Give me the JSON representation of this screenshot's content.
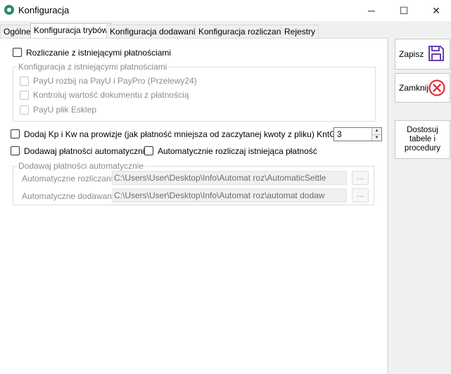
{
  "window": {
    "title": "Konfiguracja",
    "minimize": "─",
    "maximize": "☐",
    "close": "✕"
  },
  "tabs": [
    "Ogólne",
    "Konfiguracja trybów",
    "Konfiguracja dodawania",
    "Konfiguracja rozliczania",
    "Rejestry"
  ],
  "active_tab": 1,
  "settlement": {
    "checkbox_label": "Rozliczanie z istniejącymi płatnościami",
    "group_title": "Konfiguracja z istniejącymi płatnościami",
    "options": [
      "PayU rozbij na PayU i PayPro (Przelewy24)",
      "Kontroluj wartość dokumentu z płatnością",
      "PayU plik Esklep"
    ]
  },
  "commission": {
    "checkbox_label": "Dodaj Kp i Kw na prowizje (jak płatność mniejsza od zaczytanej kwoty z pliku) KntGidNumer:",
    "kntgid_value": "3"
  },
  "auto_add": {
    "checkbox_label": "Dodawaj płatności automatycznie"
  },
  "auto_settle": {
    "checkbox_label": "Automatycznie rozliczaj istniejąca płatność"
  },
  "auto_group": {
    "title": "Dodawaj płatności automatycznie",
    "rows": [
      {
        "label": "Automatyczne rozliczanie",
        "path": "C:\\Users\\User\\Desktop\\Info\\Automat roz\\AutomaticSettle",
        "browse": "..."
      },
      {
        "label": "Automatyczne dodawanie",
        "path": "C:\\Users\\User\\Desktop\\Info\\Automat roz\\automat dodaw",
        "browse": "..."
      }
    ]
  },
  "sidebar": {
    "save_label": "Zapisz",
    "close_label": "Zamknij",
    "customize_label": "Dostosuj tabele i procedury"
  },
  "colors": {
    "save_icon": "#6a3fb5",
    "close_icon": "#e0303a"
  }
}
